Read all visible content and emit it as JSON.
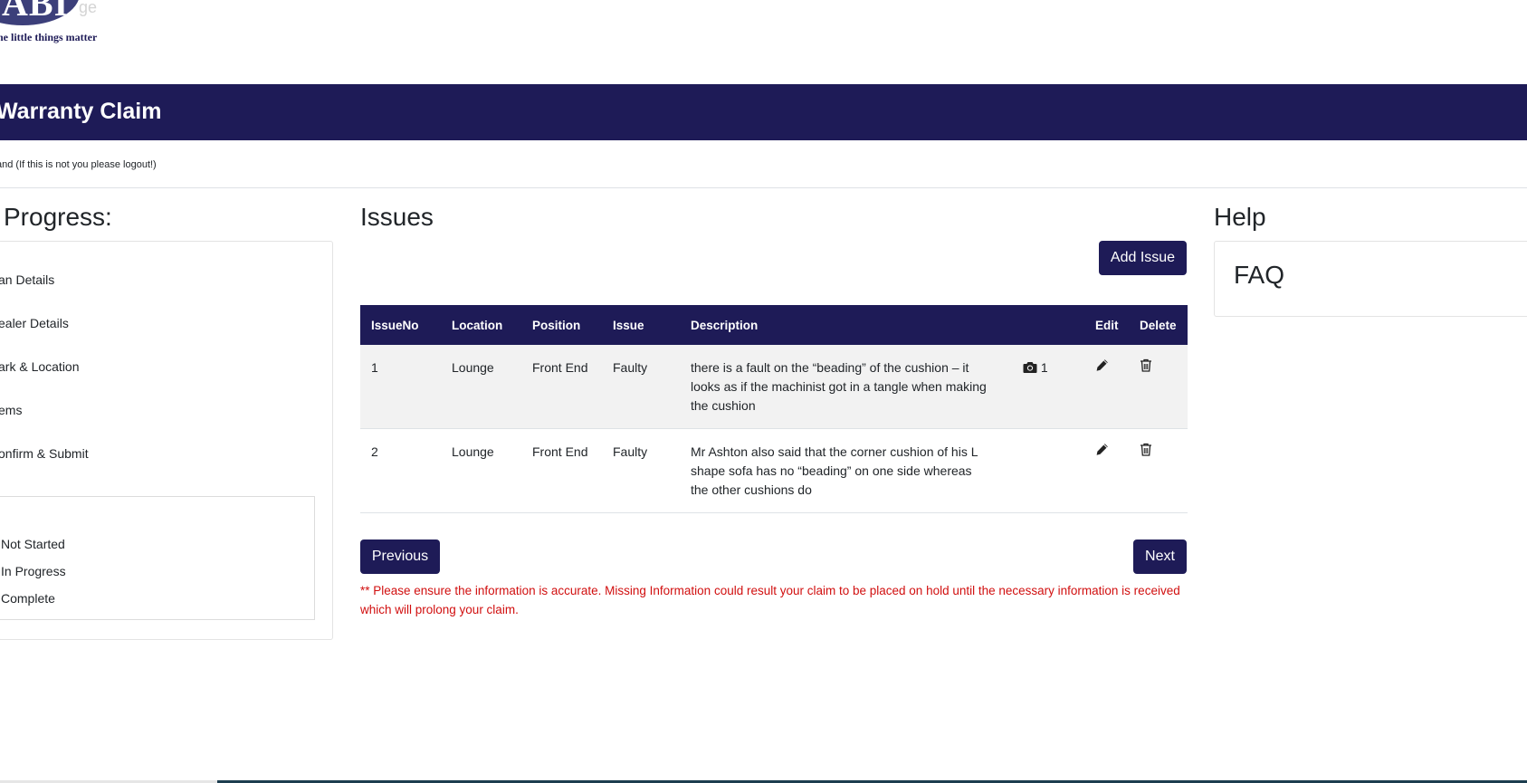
{
  "brand": {
    "tagline": "he little things matter",
    "ghost_text": "ge",
    "logo_letters": "ABI"
  },
  "header": {
    "title": "Warranty Claim"
  },
  "user": {
    "notice": "and (If this is not you please logout!)"
  },
  "progress": {
    "title": "Progress:",
    "steps": [
      "an Details",
      "ealer Details",
      "ark & Location",
      "ems",
      "onfirm & Submit"
    ],
    "legend": [
      "Not Started",
      "In Progress",
      "Complete"
    ]
  },
  "issues": {
    "title": "Issues",
    "add_button": "Add Issue",
    "columns": [
      "IssueNo",
      "Location",
      "Position",
      "Issue",
      "Description",
      "",
      "Edit",
      "Delete"
    ],
    "rows": [
      {
        "no": "1",
        "location": "Lounge",
        "position": "Front End",
        "issue": "Faulty",
        "description": "there is a fault on the “beading” of the cushion – it looks as if the machinist got in a tangle when making the cushion",
        "photos": "1"
      },
      {
        "no": "2",
        "location": "Lounge",
        "position": "Front End",
        "issue": "Faulty",
        "description": "Mr Ashton also said that the corner cushion of his L shape sofa has no “beading” on one side whereas the other cushions do",
        "photos": ""
      }
    ],
    "previous_button": "Previous",
    "next_button": "Next",
    "warning": "** Please ensure the information is accurate. Missing Information could result your claim to be placed on hold until the necessary information is received which will prolong your claim."
  },
  "help": {
    "title": "Help",
    "faq": "FAQ"
  },
  "icons": {
    "photo": "camera-icon",
    "edit": "pencil-icon",
    "delete": "trash-icon"
  },
  "colors": {
    "brand_navy": "#1e1b57",
    "warning_red": "#d10f0f",
    "row_stripe": "#f2f2f2"
  }
}
